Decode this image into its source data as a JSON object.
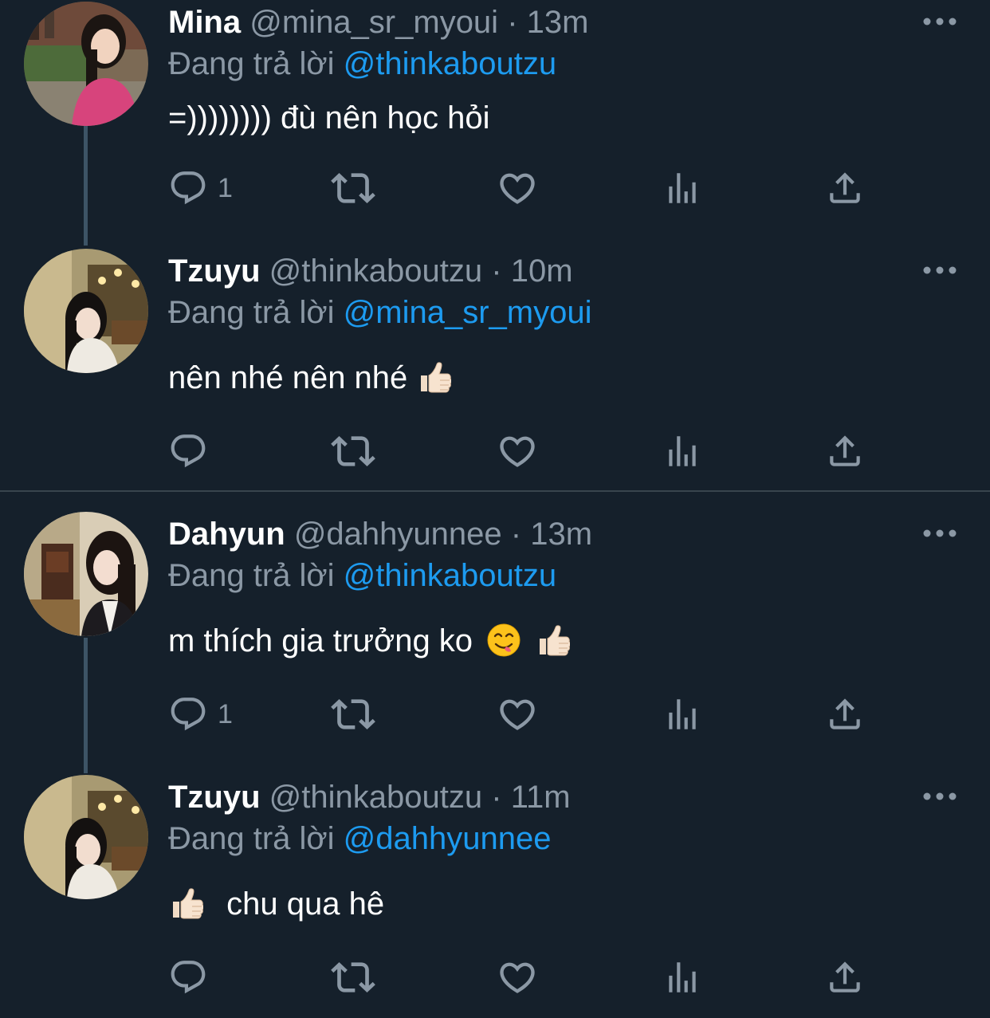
{
  "tweets": [
    {
      "display_name": "Mina",
      "handle": "@mina_sr_myoui",
      "dot": "·",
      "time": "13m",
      "reply_prefix": "Đang trả lời",
      "reply_to": "@thinkaboutzu",
      "text": "=)))))))) đù nên học hỏi",
      "emojis": [],
      "reply_count": "1"
    },
    {
      "display_name": "Tzuyu",
      "handle": "@thinkaboutzu",
      "dot": "·",
      "time": "10m",
      "reply_prefix": "Đang trả lời",
      "reply_to": "@mina_sr_myoui",
      "text": "nên nhé nên nhé",
      "emojis": [
        "thumbs-up"
      ],
      "reply_count": ""
    },
    {
      "display_name": "Dahyun",
      "handle": "@dahhyunnee",
      "dot": "·",
      "time": "13m",
      "reply_prefix": "Đang trả lời",
      "reply_to": "@thinkaboutzu",
      "text": "m thích gia trưởng ko",
      "emojis": [
        "yum-face",
        "thumbs-up"
      ],
      "reply_count": "1"
    },
    {
      "display_name": "Tzuyu",
      "handle": "@thinkaboutzu",
      "dot": "·",
      "time": "11m",
      "reply_prefix": "Đang trả lời",
      "reply_to": "@dahhyunnee",
      "text": "chu qua hê",
      "emojis": [
        "thumbs-up"
      ],
      "reply_count": ""
    }
  ],
  "icons": {
    "reply": "reply-icon",
    "retweet": "retweet-icon",
    "like": "heart-icon",
    "views": "views-icon",
    "share": "share-icon",
    "more": "more-icon"
  },
  "colors": {
    "background": "#15202b",
    "text": "#ffffff",
    "secondary": "#8b98a5",
    "accent": "#1d9bf0",
    "thread_line": "#3d5466",
    "divider": "#38444d"
  }
}
